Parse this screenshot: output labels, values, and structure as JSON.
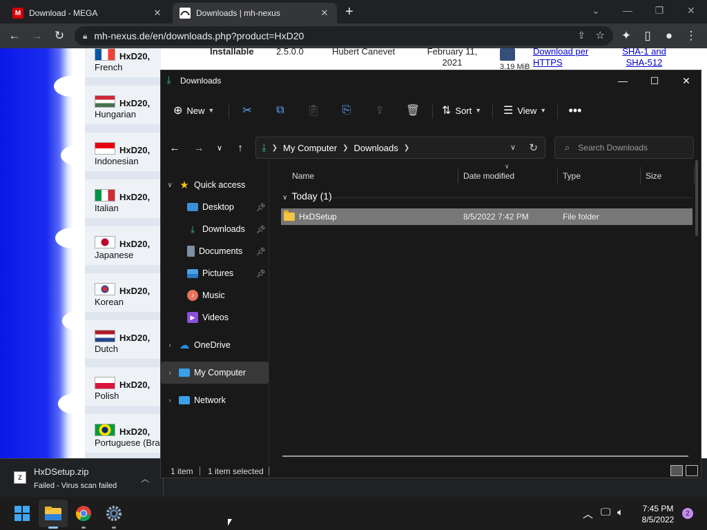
{
  "browser": {
    "tabs": [
      {
        "label": "Download - MEGA",
        "favicon": "M",
        "favicon_color": "#d90007"
      },
      {
        "label": "Downloads | mh-nexus",
        "favicon": "nexus-logo",
        "active": true
      }
    ],
    "url": "mh-nexus.de/en/downloads.php?product=HxD20"
  },
  "webpage": {
    "top_row": {
      "type_cell": "Installable",
      "version": "2.5.0.0",
      "author": "Hubert Canevet",
      "date": "February 11, 2021",
      "size": "3.19 MiB",
      "link1": "Download per HTTPS",
      "link2": "SHA-1 and SHA-512"
    },
    "languages": [
      {
        "name": "HxD20,",
        "lang": "French",
        "flag": "fr"
      },
      {
        "name": "HxD20,",
        "lang": "Hungarian",
        "flag": "hu"
      },
      {
        "name": "HxD20,",
        "lang": "Indonesian",
        "flag": "id"
      },
      {
        "name": "HxD20,",
        "lang": "Italian",
        "flag": "it"
      },
      {
        "name": "HxD20,",
        "lang": "Japanese",
        "flag": "jp"
      },
      {
        "name": "HxD20,",
        "lang": "Korean",
        "flag": "kr"
      },
      {
        "name": "HxD20,",
        "lang": "Dutch",
        "flag": "nl"
      },
      {
        "name": "HxD20,",
        "lang": "Polish",
        "flag": "pl"
      },
      {
        "name": "HxD20,",
        "lang": "Portuguese (Bra",
        "flag": "br"
      }
    ]
  },
  "download_bar": {
    "filename": "HxDSetup.zip",
    "status": "Failed - Virus scan failed"
  },
  "explorer": {
    "title": "Downloads",
    "commands": {
      "new": "New",
      "sort": "Sort",
      "view": "View"
    },
    "breadcrumb": [
      "My Computer",
      "Downloads"
    ],
    "search_placeholder": "Search Downloads",
    "nav": {
      "quick_access": "Quick access",
      "desktop": "Desktop",
      "downloads": "Downloads",
      "documents": "Documents",
      "pictures": "Pictures",
      "music": "Music",
      "videos": "Videos",
      "onedrive": "OneDrive",
      "my_computer": "My Computer",
      "network": "Network"
    },
    "columns": {
      "name": "Name",
      "date": "Date modified",
      "type": "Type",
      "size": "Size"
    },
    "group": "Today (1)",
    "files": [
      {
        "name": "HxDSetup",
        "date": "8/5/2022 7:42 PM",
        "type": "File folder",
        "size": ""
      }
    ],
    "status": {
      "count": "1 item",
      "selected": "1 item selected"
    }
  },
  "taskbar": {
    "time": "7:45 PM",
    "date": "8/5/2022",
    "notifications": "2"
  }
}
